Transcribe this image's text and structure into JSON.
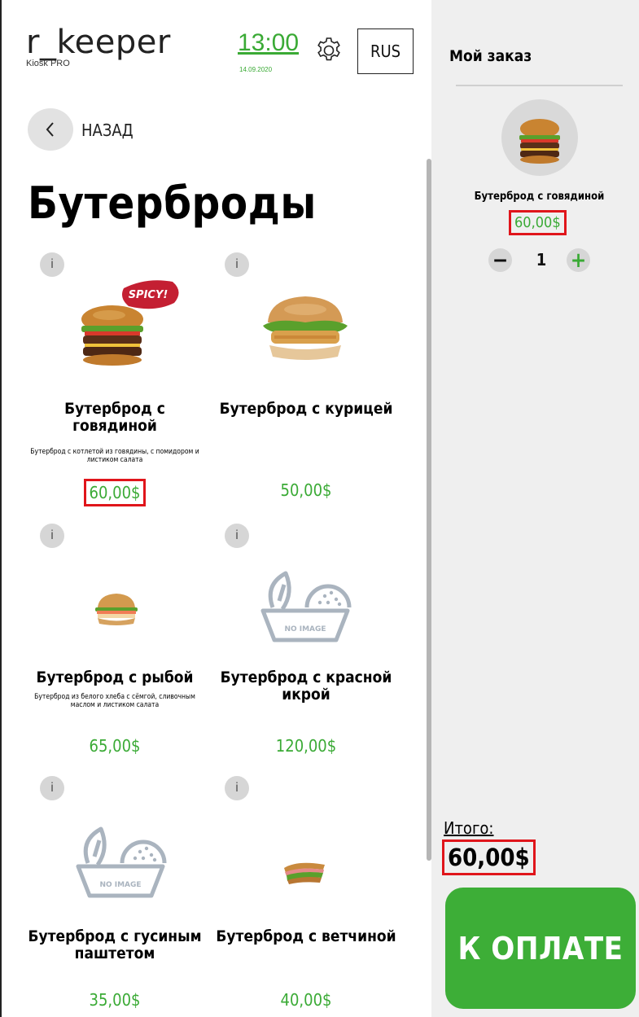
{
  "header": {
    "logo": "r_keeper",
    "logo_sub": "Kiosk PRO",
    "time": "13:00",
    "date": "14.09.2020",
    "language": "RUS"
  },
  "nav": {
    "back_label": "НАЗАД"
  },
  "page_title": "Бутерброды",
  "products": [
    {
      "name": "Бутерброд с говядиной",
      "description": "Бутерброд с котлетой из говядины, с помидором и листиком салата",
      "price": "60,00$",
      "image": "beef-burger",
      "badge": "SPICY!"
    },
    {
      "name": "Бутерброд с курицей",
      "description": "",
      "price": "50,00$",
      "image": "chicken-burger"
    },
    {
      "name": "Бутерброд с рыбой",
      "description": "Бутерброд из белого хлеба с сёмгой, сливочным маслом и листиком салата",
      "price": "65,00$",
      "image": "fish-burger"
    },
    {
      "name": "Бутерброд с красной икрой",
      "description": "",
      "price": "120,00$",
      "image": "no-image",
      "no_image_label": "NO IMAGE"
    },
    {
      "name": "Бутерброд с гусиным паштетом",
      "description": "",
      "price": "35,00$",
      "image": "no-image",
      "no_image_label": "NO IMAGE"
    },
    {
      "name": "Бутерброд с ветчиной",
      "description": "",
      "price": "40,00$",
      "image": "ham-sandwich"
    }
  ],
  "info_label": "i",
  "order": {
    "title": "Мой заказ",
    "items": [
      {
        "name": "Бутерброд с говядиной",
        "price": "60,00$",
        "quantity": "1"
      }
    ],
    "minus": "−",
    "plus": "+",
    "total_label": "Итого:",
    "total_value": "60,00$",
    "pay_label": "К ОПЛАТЕ"
  },
  "colors": {
    "accent_green": "#3aaa35",
    "highlight_red": "#e0151b",
    "sidebar_bg": "#efefef"
  }
}
